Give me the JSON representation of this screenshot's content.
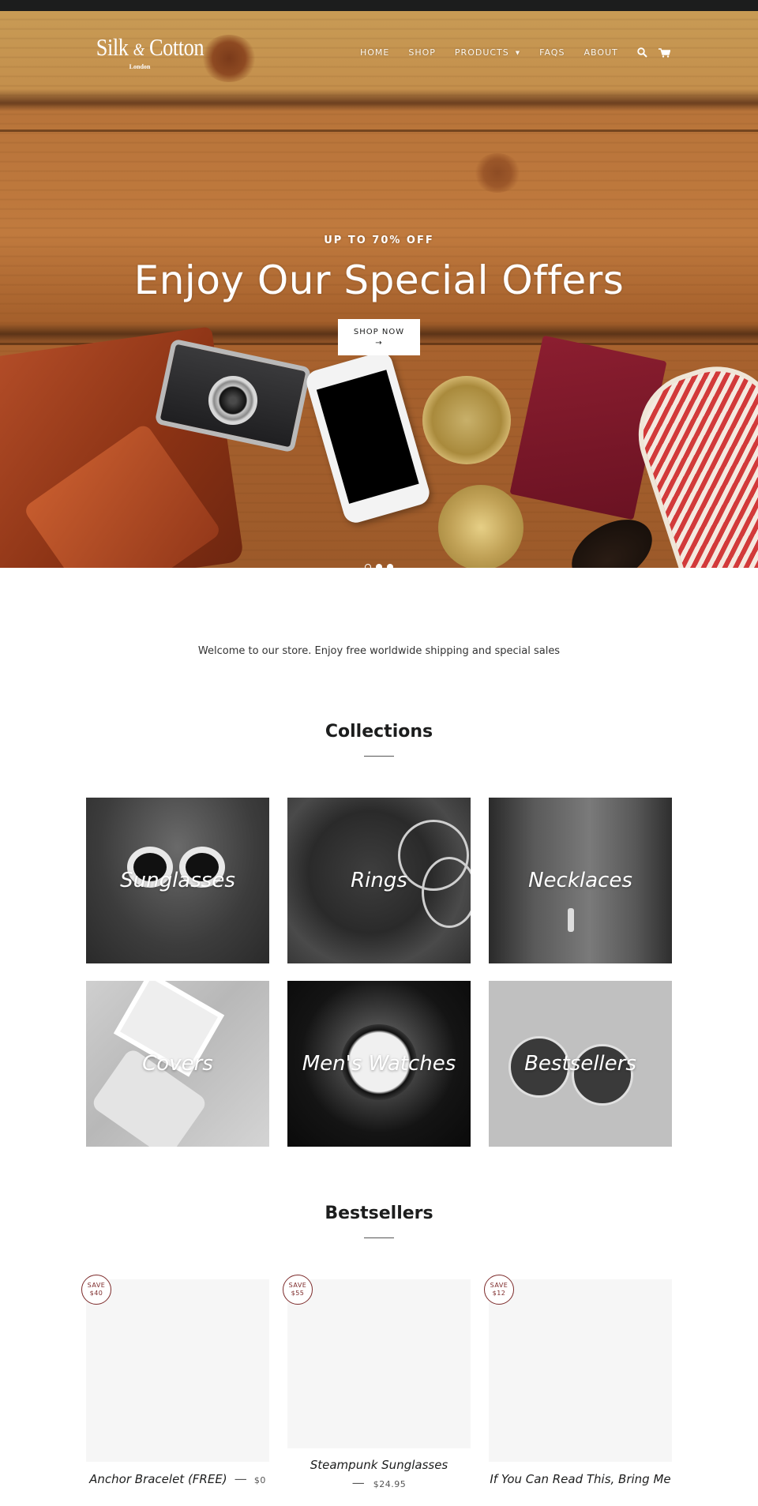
{
  "header": {
    "logo": {
      "brand_left": "Silk",
      "ampersand": "&",
      "brand_right": "Cotton",
      "tagline": "London"
    },
    "nav": [
      {
        "label": "HOME"
      },
      {
        "label": "SHOP"
      },
      {
        "label": "PRODUCTS",
        "has_dropdown": true
      },
      {
        "label": "FAQS"
      },
      {
        "label": "ABOUT"
      }
    ],
    "icons": {
      "search": "search-icon",
      "cart": "cart-icon"
    }
  },
  "hero": {
    "subtitle": "UP TO 70% OFF",
    "title": "Enjoy Our Special Offers",
    "button_label": "SHOP NOW",
    "button_arrow": "→",
    "slides_count": 3,
    "active_slide": 1
  },
  "welcome": {
    "text": "Welcome to our store. Enjoy free worldwide shipping and special sales"
  },
  "collections": {
    "title": "Collections",
    "items": [
      {
        "label": "Sunglasses"
      },
      {
        "label": "Rings"
      },
      {
        "label": "Necklaces"
      },
      {
        "label": "Covers"
      },
      {
        "label": "Men's Watches"
      },
      {
        "label": "Bestsellers"
      }
    ]
  },
  "bestsellers": {
    "title": "Bestsellers",
    "items": [
      {
        "badge_top": "SAVE",
        "badge_amount": "$40",
        "title": "Anchor Bracelet (FREE)",
        "dash": "—",
        "price": "$0"
      },
      {
        "badge_top": "SAVE",
        "badge_amount": "$55",
        "title": "Steampunk Sunglasses",
        "dash": "—",
        "price": "$24.95"
      },
      {
        "badge_top": "SAVE",
        "badge_amount": "$12",
        "title": "If You Can Read This, Bring Me",
        "dash": "",
        "price": ""
      }
    ]
  },
  "colors": {
    "topbar": "#1c1d1d",
    "badge": "#7d2b2b",
    "product_placeholder": "#f6f6f6",
    "text": "#1c1d1d"
  }
}
